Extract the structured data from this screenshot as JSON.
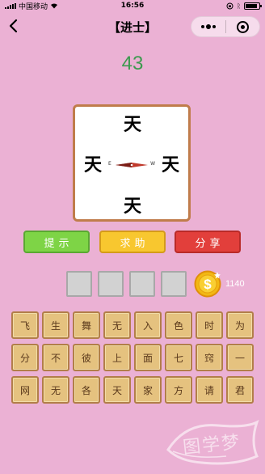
{
  "status_bar": {
    "carrier": "中国移动",
    "time": "16:56"
  },
  "nav": {
    "title": "【进士】"
  },
  "level": "43",
  "puzzle": {
    "top": "天",
    "left": "天",
    "right": "天",
    "bottom": "天",
    "compass_e": "E",
    "compass_w": "W"
  },
  "buttons": {
    "hint": "提示",
    "help": "求助",
    "share": "分享"
  },
  "coins": "1140",
  "answer_slots": [
    "",
    "",
    "",
    ""
  ],
  "candidates": [
    [
      "飞",
      "生",
      "舞",
      "无",
      "入",
      "色",
      "时",
      "为"
    ],
    [
      "分",
      "不",
      "彼",
      "上",
      "面",
      "七",
      "窍",
      "一"
    ],
    [
      "网",
      "无",
      "各",
      "天",
      "家",
      "方",
      "请",
      "君"
    ]
  ],
  "watermark": "图学梦",
  "colors": {
    "background": "#ebb1d4",
    "level_green": "#3d9a4f",
    "hint_green": "#7ed446",
    "help_yellow": "#f8c72f",
    "share_red": "#e23f3b",
    "tile": "#e5c27f"
  }
}
